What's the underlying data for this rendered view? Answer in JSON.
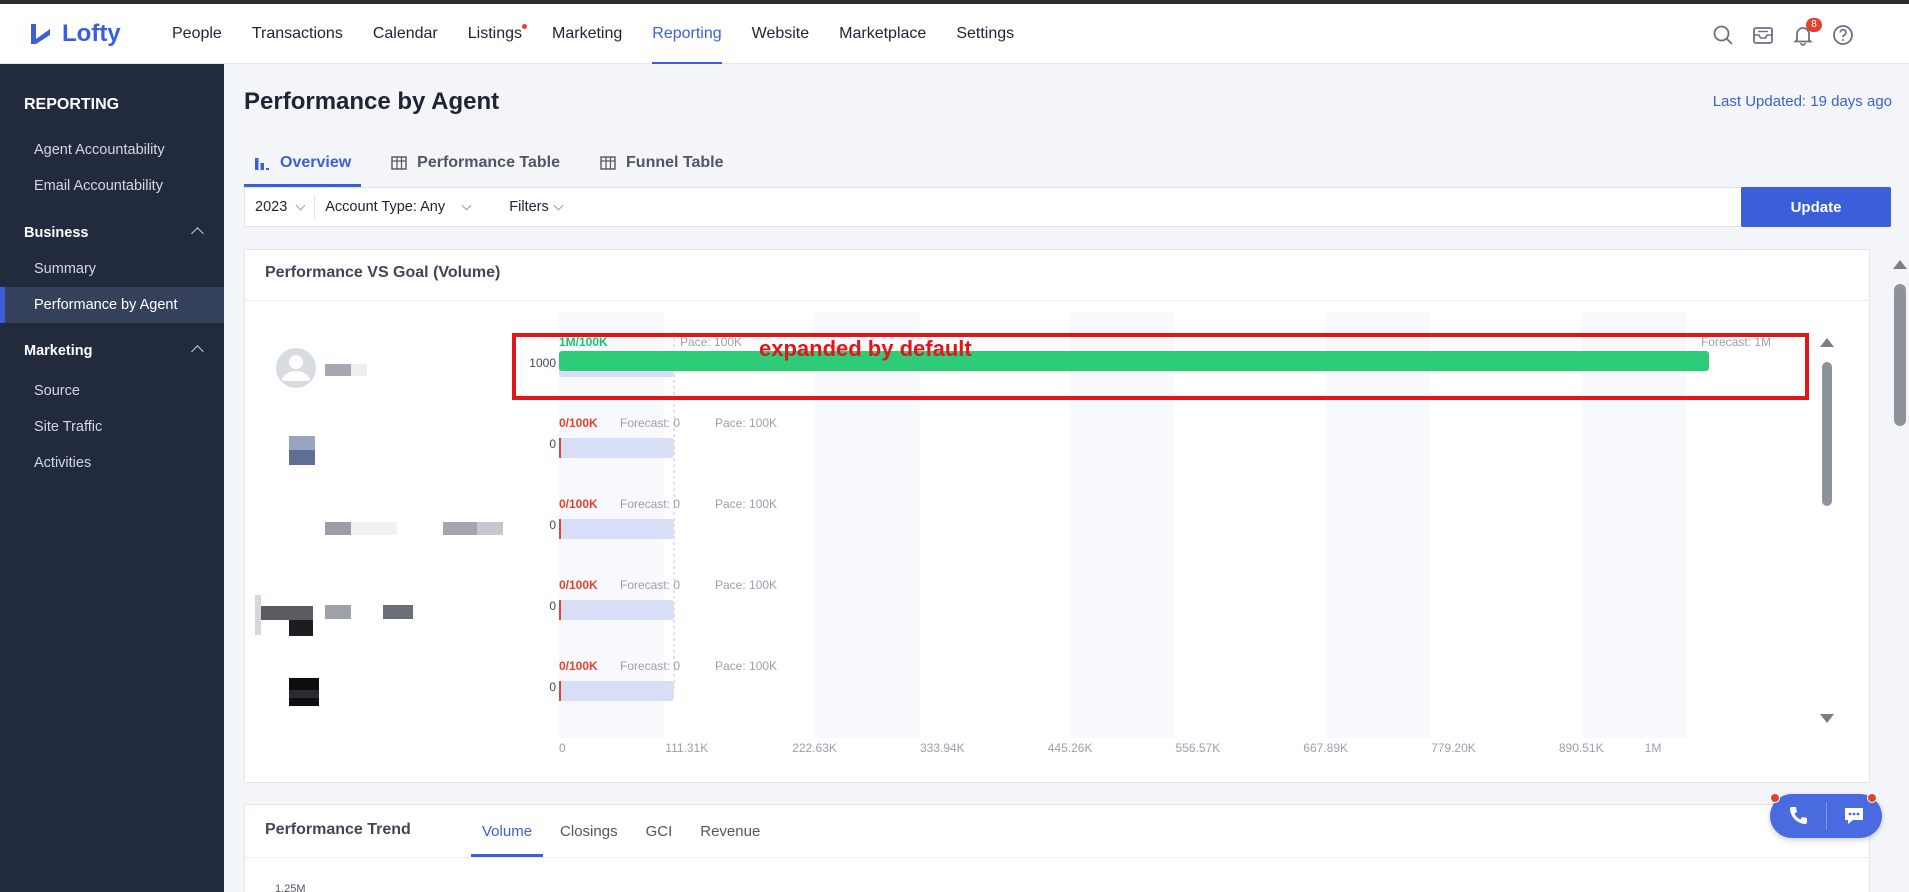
{
  "app": {
    "logo_text": "Lofty"
  },
  "nav": {
    "items": [
      {
        "label": "People"
      },
      {
        "label": "Transactions"
      },
      {
        "label": "Calendar"
      },
      {
        "label": "Listings"
      },
      {
        "label": "Marketing"
      },
      {
        "label": "Reporting"
      },
      {
        "label": "Website"
      },
      {
        "label": "Marketplace"
      },
      {
        "label": "Settings"
      }
    ],
    "active": "Reporting",
    "notification_count": "8"
  },
  "sidebar": {
    "title": "REPORTING",
    "items_top": [
      {
        "label": "Agent Accountability"
      },
      {
        "label": "Email Accountability"
      }
    ],
    "business": {
      "label": "Business",
      "items": [
        {
          "label": "Summary"
        },
        {
          "label": "Performance by Agent"
        }
      ]
    },
    "marketing": {
      "label": "Marketing",
      "items": [
        {
          "label": "Source"
        },
        {
          "label": "Site Traffic"
        },
        {
          "label": "Activities"
        }
      ]
    }
  },
  "page": {
    "title": "Performance by Agent",
    "last_updated": "Last Updated: 19 days ago",
    "tabs": [
      {
        "label": "Overview"
      },
      {
        "label": "Performance Table"
      },
      {
        "label": "Funnel Table"
      }
    ]
  },
  "filters": {
    "year": "2023",
    "account_type": "Account Type: Any",
    "filters_label": "Filters",
    "update_label": "Update"
  },
  "card": {
    "title": "Performance VS Goal (Volume)",
    "annotation": "expanded by default"
  },
  "chart_data": {
    "type": "bar",
    "orientation": "horizontal",
    "title": "Performance VS Goal (Volume)",
    "x_ticks": [
      "0",
      "111.31K",
      "222.63K",
      "333.94K",
      "445.26K",
      "556.57K",
      "667.89K",
      "779.20K",
      "890.51K",
      "1M"
    ],
    "xlim": [
      0,
      1000000
    ],
    "pace_value": 100000,
    "series": [
      {
        "value": 1000000,
        "y_label": "1000",
        "status": "1M/100K",
        "forecast": "Forecast: 1M",
        "pace": "Pace: 100K",
        "status_color": "#1fbf6b"
      },
      {
        "value": 0,
        "y_label": "0",
        "status": "0/100K",
        "forecast": "Forecast: 0",
        "pace": "Pace: 100K",
        "status_color": "#e5412f"
      },
      {
        "value": 0,
        "y_label": "0",
        "status": "0/100K",
        "forecast": "Forecast: 0",
        "pace": "Pace: 100K",
        "status_color": "#e5412f"
      },
      {
        "value": 0,
        "y_label": "0",
        "status": "0/100K",
        "forecast": "Forecast: 0",
        "pace": "Pace: 100K",
        "status_color": "#e5412f"
      },
      {
        "value": 0,
        "y_label": "0",
        "status": "0/100K",
        "forecast": "Forecast: 0",
        "pace": "Pace: 100K",
        "status_color": "#e5412f"
      }
    ],
    "colors": {
      "bar": "#2ecc78",
      "pace_bar": "#d9def7",
      "highlight": "#e5141b"
    }
  },
  "trend": {
    "title": "Performance Trend",
    "tabs": [
      {
        "label": "Volume"
      },
      {
        "label": "Closings"
      },
      {
        "label": "GCI"
      },
      {
        "label": "Revenue"
      }
    ],
    "y_top": "1.25M"
  }
}
